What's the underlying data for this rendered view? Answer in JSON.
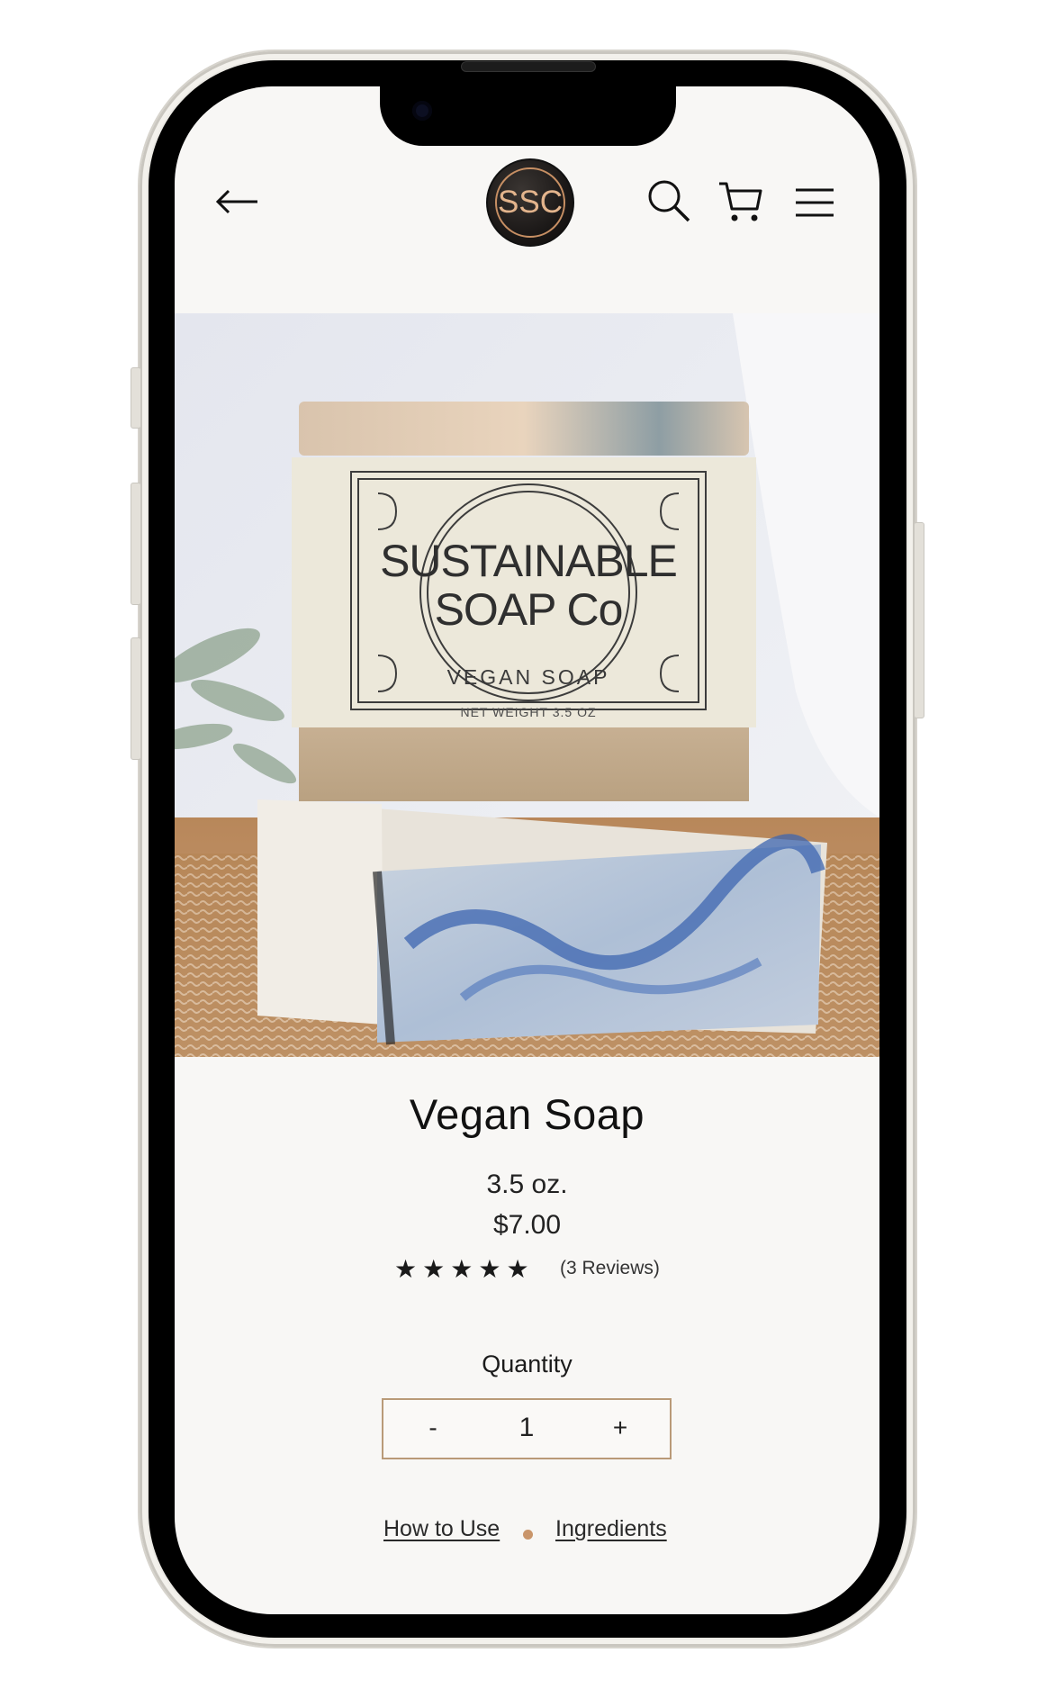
{
  "header": {
    "logo_text": "SSC",
    "icons": [
      "arrow-left-icon",
      "search-icon",
      "cart-icon",
      "menu-icon"
    ]
  },
  "hero": {
    "label_brand_line1": "SUSTAINABLE",
    "label_brand_line2": "SOAP Co",
    "label_product": "VEGAN SOAP",
    "label_weight": "NET WEIGHT 3.5 OZ"
  },
  "product": {
    "title": "Vegan Soap",
    "size": "3.5 oz.",
    "price": "$7.00",
    "rating_stars": 5,
    "rating_max": 5,
    "reviews_text": "(3 Reviews)"
  },
  "quantity": {
    "label": "Quantity",
    "minus": "-",
    "value": "1",
    "plus": "+"
  },
  "links": {
    "how_to_use": "How to Use",
    "ingredients": "Ingredients"
  },
  "colors": {
    "accent_border": "#b99a78",
    "dot": "#c9956a",
    "logo_gold": "#e3b48c",
    "background": "#f8f7f5"
  }
}
